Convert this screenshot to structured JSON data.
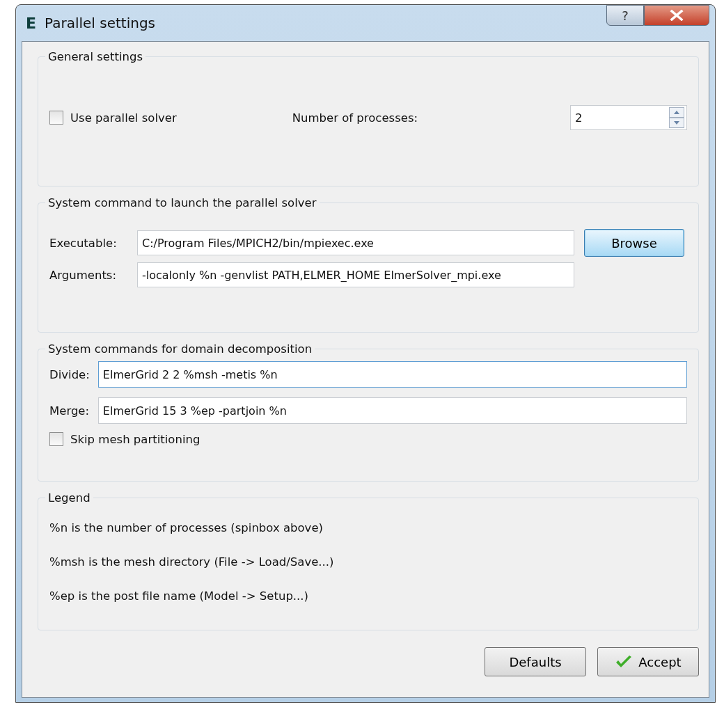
{
  "window": {
    "title": "Parallel settings",
    "app_letter": "E",
    "help_button": "?"
  },
  "general": {
    "title": "General settings",
    "use_parallel": {
      "label": "Use parallel solver",
      "checked": false
    },
    "processes_label": "Number of processes:",
    "processes_value": "2"
  },
  "launch": {
    "title": "System command to launch the parallel solver",
    "fields": [
      {
        "label": "Executable:",
        "value": "C:/Program Files/MPICH2/bin/mpiexec.exe",
        "button": "Browse"
      },
      {
        "label": "Arguments:",
        "value": "-localonly %n -genvlist PATH,ELMER_HOME ElmerSolver_mpi.exe"
      }
    ]
  },
  "decomposition": {
    "title": "System commands for domain decomposition",
    "fields": [
      {
        "label": "Divide:",
        "value": "ElmerGrid 2 2 %msh -metis %n",
        "focused": true
      },
      {
        "label": "Merge:",
        "value": "ElmerGrid 15 3 %ep -partjoin %n",
        "focused": false
      }
    ],
    "skip": {
      "label": "Skip mesh partitioning",
      "checked": false
    }
  },
  "legend": {
    "title": "Legend",
    "lines": [
      "%n is the number of processes (spinbox above)",
      "%msh is the mesh directory (File -> Load/Save...)",
      "%ep is the post file name (Model -> Setup...)"
    ]
  },
  "buttons": [
    {
      "label": "Defaults",
      "icon": false
    },
    {
      "label": "Accept",
      "icon": true
    }
  ]
}
